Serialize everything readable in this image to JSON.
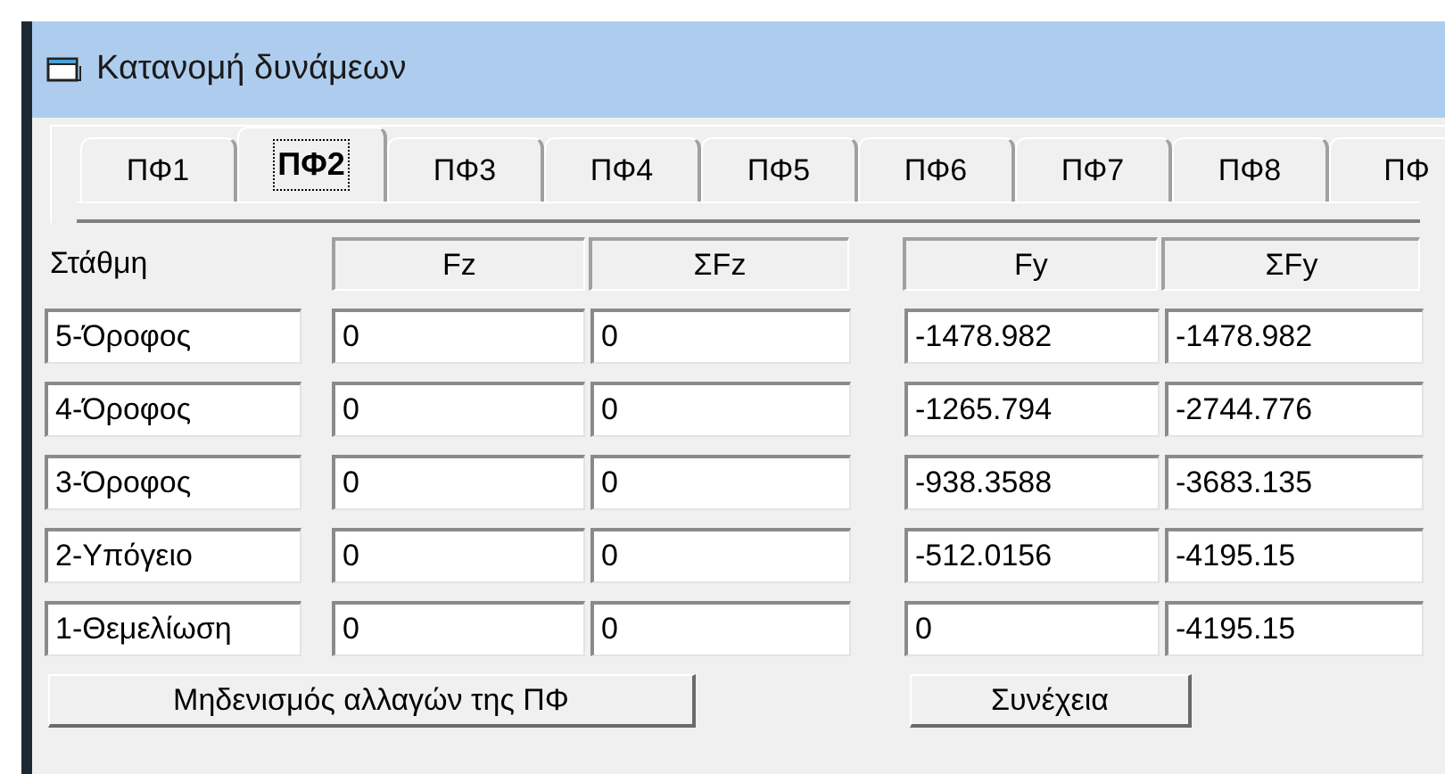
{
  "window": {
    "title": "Κατανομή δυνάμεων"
  },
  "tabs": [
    {
      "label": "ΠΦ1",
      "selected": false
    },
    {
      "label": "ΠΦ2",
      "selected": true
    },
    {
      "label": "ΠΦ3",
      "selected": false
    },
    {
      "label": "ΠΦ4",
      "selected": false
    },
    {
      "label": "ΠΦ5",
      "selected": false
    },
    {
      "label": "ΠΦ6",
      "selected": false
    },
    {
      "label": "ΠΦ7",
      "selected": false
    },
    {
      "label": "ΠΦ8",
      "selected": false
    },
    {
      "label": "ΠΦ",
      "selected": false
    }
  ],
  "table": {
    "row_header": "Στάθμη",
    "columns": [
      "Fz",
      "ΣFz",
      "Fy",
      "ΣFy"
    ],
    "rows": [
      {
        "level_name": "5-Όροφος",
        "values": [
          "0",
          "0",
          "-1478.982",
          "-1478.982"
        ]
      },
      {
        "level_name": "4-Όροφος",
        "values": [
          "0",
          "0",
          "-1265.794",
          "-2744.776"
        ]
      },
      {
        "level_name": "3-Όροφος",
        "values": [
          "0",
          "0",
          "-938.3588",
          "-3683.135"
        ]
      },
      {
        "level_name": "2-Υπόγειο",
        "values": [
          "0",
          "0",
          "-512.0156",
          "-4195.15"
        ]
      },
      {
        "level_name": "1-Θεμελίωση",
        "values": [
          "0",
          "0",
          "0",
          "-4195.15"
        ]
      }
    ]
  },
  "buttons": [
    "Μηδενισμός αλλαγών της ΠΦ",
    "Συνέχεια"
  ]
}
